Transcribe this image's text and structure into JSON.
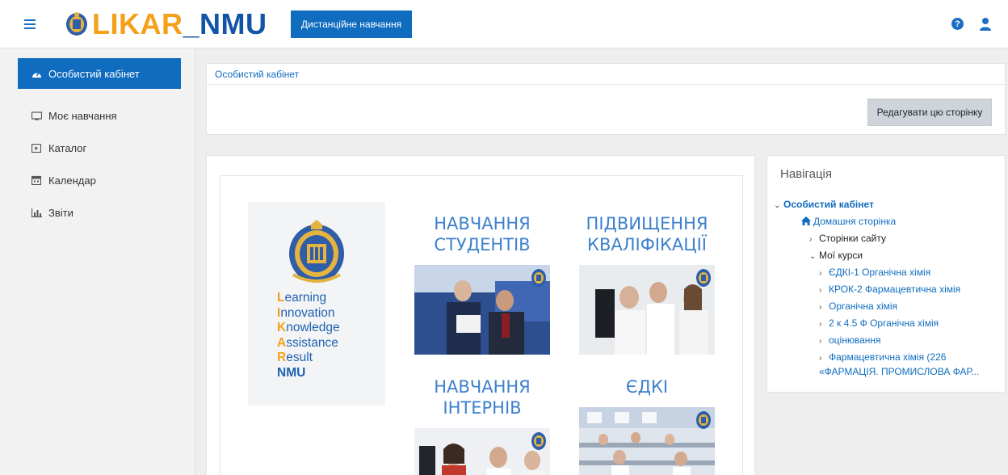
{
  "topbar": {
    "logo": {
      "part1": "LIKAR",
      "part2": "_NMU"
    },
    "pill_label": "Дистанційне навчання",
    "help_glyph": "?",
    "icons": {
      "menu": "hamburger-icon",
      "help": "question-circle-icon",
      "user": "user-icon"
    }
  },
  "drawer": {
    "items": [
      {
        "label": "Особистий кабінет",
        "icon": "dashboard-icon"
      },
      {
        "label": "Моє навчання",
        "icon": "tv-icon"
      },
      {
        "label": "Каталог",
        "icon": "square-play-icon"
      },
      {
        "label": "Календар",
        "icon": "calendar-icon"
      },
      {
        "label": "Звіти",
        "icon": "chart-icon"
      }
    ]
  },
  "header": {
    "breadcrumb": "Особистий кабінет",
    "edit_button": "Редагувати цю сторінку"
  },
  "main": {
    "acronym": [
      {
        "cap": "L",
        "rest": "earning"
      },
      {
        "cap": "I",
        "rest": "nnovation"
      },
      {
        "cap": "K",
        "rest": "nowledge"
      },
      {
        "cap": "A",
        "rest": "ssistance"
      },
      {
        "cap": "R",
        "rest": "esult"
      }
    ],
    "acronym_last": "NMU",
    "tiles": [
      {
        "line1": "НАВЧАННЯ",
        "line2": "СТУДЕНТІВ"
      },
      {
        "line1": "ПІДВИЩЕННЯ",
        "line2": "КВАЛІФІКАЦІЇ"
      },
      {
        "line1": "НАВЧАННЯ",
        "line2": "ІНТЕРНІВ"
      },
      {
        "line1": "ЄДКІ",
        "line2": ""
      }
    ]
  },
  "navigation": {
    "title": "Навігація",
    "dashboard": "Особистий кабінет",
    "home": "Домашня сторінка",
    "site_pages": "Сторінки сайту",
    "my_courses": "Мої курси",
    "courses": [
      "ЄДКІ-1 Органічна хімія",
      "КРОК-2 Фармацевтична хімія",
      "Органічна хімія",
      "2 к 4.5 Ф Органічна хімія",
      "оцінювання",
      "Фармацевтична хімія (226"
    ],
    "course_cont": "«ФАРМАЦІЯ. ПРОМИСЛОВА ФАР..."
  }
}
